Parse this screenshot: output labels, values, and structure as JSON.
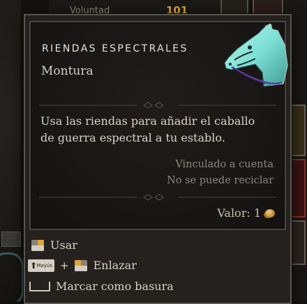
{
  "background": {
    "top_label": "Voluntad",
    "top_value": "101"
  },
  "item": {
    "name": "RIENDAS ESPECTRALES",
    "type": "Montura",
    "description": "Usa las riendas para añadir el caballo de guerra espectral a tu establo.",
    "bound": "Vinculado a cuenta",
    "recycle": "No se puede reciclar",
    "value_text": "Valor: 1",
    "image_icon": "spectral-horse-icon"
  },
  "actions": {
    "use_label": "Usar",
    "link_modifier_key": "Mayús",
    "link_plus": "+",
    "link_label": "Enlazar",
    "junk_label": "Marcar como basura"
  },
  "colors": {
    "horse": "#7ee1d6",
    "coin": "#d6a23c",
    "tooltip_border": "#5a5650"
  }
}
